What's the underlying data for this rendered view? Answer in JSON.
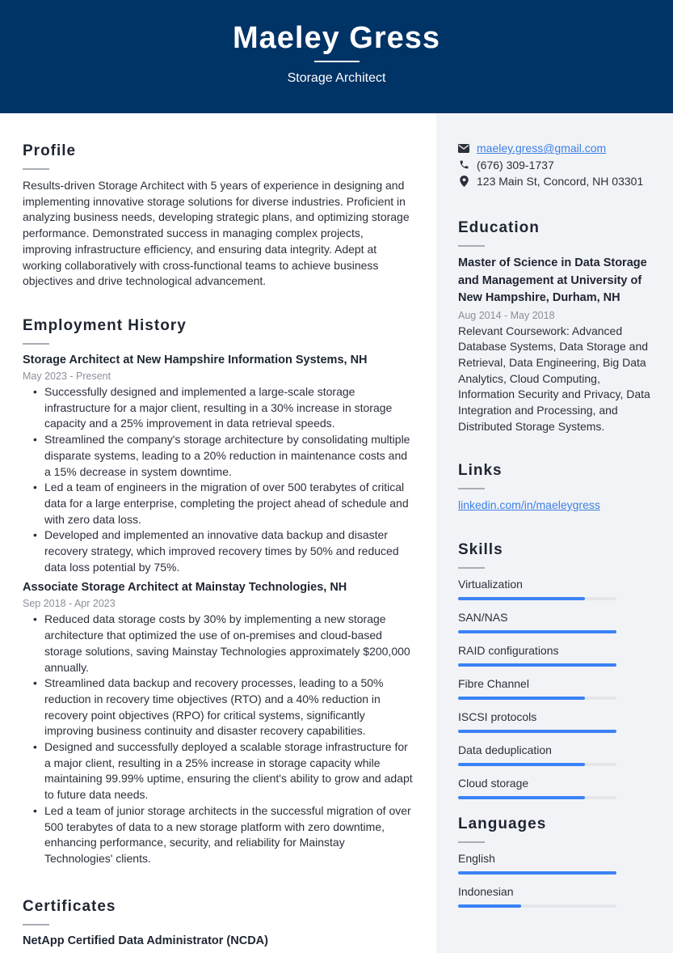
{
  "header": {
    "name": "Maeley Gress",
    "title": "Storage Architect"
  },
  "profile": {
    "heading": "Profile",
    "text": "Results-driven Storage Architect with 5 years of experience in designing and implementing innovative storage solutions for diverse industries. Proficient in analyzing business needs, developing strategic plans, and optimizing storage performance. Demonstrated success in managing complex projects, improving infrastructure efficiency, and ensuring data integrity. Adept at working collaboratively with cross-functional teams to achieve business objectives and drive technological advancement."
  },
  "employment": {
    "heading": "Employment History",
    "jobs": [
      {
        "title": "Storage Architect at New Hampshire Information Systems, NH",
        "dates": "May 2023 - Present",
        "bullets": [
          "Successfully designed and implemented a large-scale storage infrastructure for a major client, resulting in a 30% increase in storage capacity and a 25% improvement in data retrieval speeds.",
          "Streamlined the company's storage architecture by consolidating multiple disparate systems, leading to a 20% reduction in maintenance costs and a 15% decrease in system downtime.",
          "Led a team of engineers in the migration of over 500 terabytes of critical data for a large enterprise, completing the project ahead of schedule and with zero data loss.",
          "Developed and implemented an innovative data backup and disaster recovery strategy, which improved recovery times by 50% and reduced data loss potential by 75%."
        ]
      },
      {
        "title": "Associate Storage Architect at Mainstay Technologies, NH",
        "dates": "Sep 2018 - Apr 2023",
        "bullets": [
          "Reduced data storage costs by 30% by implementing a new storage architecture that optimized the use of on-premises and cloud-based storage solutions, saving Mainstay Technologies approximately $200,000 annually.",
          "Streamlined data backup and recovery processes, leading to a 50% reduction in recovery time objectives (RTO) and a 40% reduction in recovery point objectives (RPO) for critical systems, significantly improving business continuity and disaster recovery capabilities.",
          "Designed and successfully deployed a scalable storage infrastructure for a major client, resulting in a 25% increase in storage capacity while maintaining 99.99% uptime, ensuring the client's ability to grow and adapt to future data needs.",
          "Led a team of junior storage architects in the successful migration of over 500 terabytes of data to a new storage platform with zero downtime, enhancing performance, security, and reliability for Mainstay Technologies' clients."
        ]
      }
    ]
  },
  "certificates": {
    "heading": "Certificates",
    "items": [
      "NetApp Certified Data Administrator (NCDA)"
    ]
  },
  "contact": {
    "email": "maeley.gress@gmail.com",
    "phone": "(676) 309-1737",
    "address": "123 Main St, Concord, NH 03301",
    "icons": {
      "email": "envelope-icon",
      "phone": "phone-icon",
      "address": "map-pin-icon"
    }
  },
  "education": {
    "heading": "Education",
    "degree": "Master of Science in Data Storage and Management at University of New Hampshire, Durham, NH",
    "dates": "Aug 2014 - May 2018",
    "description": "Relevant Coursework: Advanced Database Systems, Data Storage and Retrieval, Data Engineering, Big Data Analytics, Cloud Computing, Information Security and Privacy, Data Integration and Processing, and Distributed Storage Systems."
  },
  "links": {
    "heading": "Links",
    "items": [
      "linkedin.com/in/maeleygress"
    ]
  },
  "skills": {
    "heading": "Skills",
    "items": [
      {
        "name": "Virtualization",
        "level": 0.8
      },
      {
        "name": "SAN/NAS",
        "level": 1.0
      },
      {
        "name": "RAID configurations",
        "level": 1.0
      },
      {
        "name": "Fibre Channel",
        "level": 0.8
      },
      {
        "name": "ISCSI protocols",
        "level": 1.0
      },
      {
        "name": "Data deduplication",
        "level": 0.8
      },
      {
        "name": "Cloud storage",
        "level": 0.8
      }
    ]
  },
  "languages": {
    "heading": "Languages",
    "items": [
      {
        "name": "English",
        "level": 1.0
      },
      {
        "name": "Indonesian",
        "level": 0.4
      }
    ]
  },
  "colors": {
    "header_bg": "#003366",
    "sidebar_bg": "#f2f3f6",
    "accent": "#3b82f6",
    "link": "#3b7fe6"
  }
}
